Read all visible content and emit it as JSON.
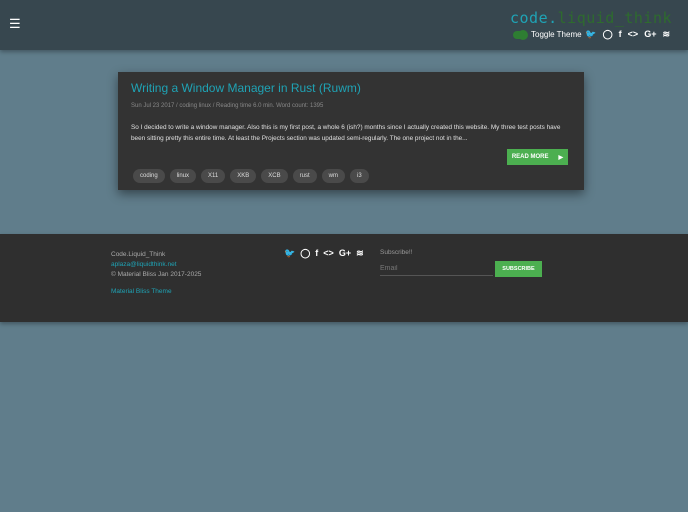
{
  "header": {
    "menu_icon": "☰",
    "logo_part1": "code",
    "logo_dot": ".",
    "logo_part2": "liquid_think",
    "toggle_label": "Toggle Theme",
    "social": [
      "twitter",
      "github",
      "facebook",
      "code",
      "google-plus",
      "rss"
    ],
    "social_glyphs": [
      "🐦",
      "◯",
      "f",
      "<>",
      "G+",
      "≋"
    ]
  },
  "post": {
    "title": "Writing a Window Manager in Rust (Ruwm)",
    "meta": "Sun Jul 23 2017 / coding linux / Reading time 6.0 min. Word count: 1395",
    "excerpt": "So I decided to write a window manager. Also this is my first post, a whole 6 (ish?) months since I actually created this website. My three test posts have been sitting pretty this entire time. At least the Projects section was updated semi-regularly. The one project not in the...",
    "read_more": "READ MORE",
    "read_more_icon": "▶",
    "tags": [
      "coding",
      "linux",
      "X11",
      "XKB",
      "XCB",
      "rust",
      "wm",
      "i3"
    ]
  },
  "footer": {
    "site": "Code.Liquid_Think",
    "email": "aplaza@liquidthink.net",
    "copyright": "© Material Bliss Jan 2017-2025",
    "theme_link": "Material Bliss Theme",
    "subscribe_label": "Subscribe!!",
    "email_placeholder": "Email",
    "subscribe_button": "SUBSCRIBE"
  }
}
